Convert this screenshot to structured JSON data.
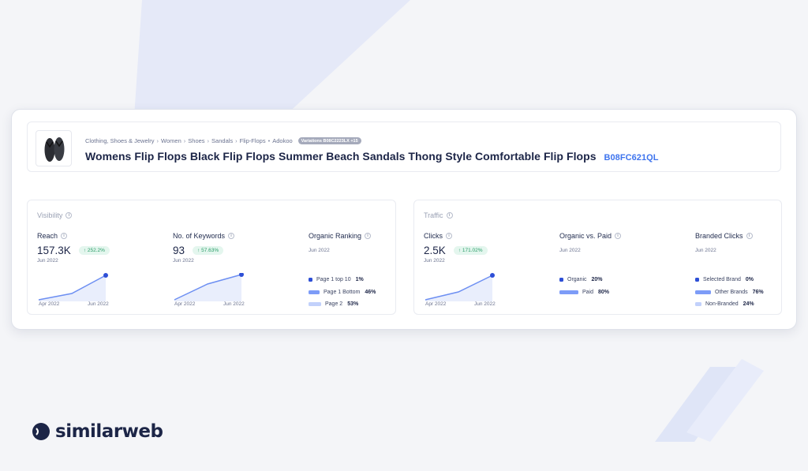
{
  "product": {
    "breadcrumb": [
      "Clothing, Shoes & Jewelry",
      "Women",
      "Shoes",
      "Sandals",
      "Flip-Flops"
    ],
    "brand": "Adokoo",
    "variations_badge": "Variations B08C2223LX +15",
    "title": "Womens Flip Flops Black Flip Flops Summer Beach Sandals Thong Style Comfortable Flip Flops",
    "asin": "B08FC621QL",
    "thumbnail_icon": "flip-flops-icon"
  },
  "visibility": {
    "title": "Visibility",
    "reach": {
      "label": "Reach",
      "value": "157.3K",
      "change": "↑ 252.2%",
      "date": "Jun 2022",
      "axis_start": "Apr 2022",
      "axis_end": "Jun 2022"
    },
    "keywords": {
      "label": "No. of Keywords",
      "value": "93",
      "change": "↑ 57.63%",
      "date": "Jun 2022",
      "axis_start": "Apr 2022",
      "axis_end": "Jun 2022"
    },
    "organic_ranking": {
      "label": "Organic Ranking",
      "date": "Jun 2022",
      "items": [
        {
          "label": "Page 1 top 10",
          "value": "1%",
          "color": "#2e4fd6"
        },
        {
          "label": "Page 1 Bottom",
          "value": "46%",
          "color": "#7d9cf7"
        },
        {
          "label": "Page 2",
          "value": "53%",
          "color": "#c2d1fb"
        }
      ]
    }
  },
  "traffic": {
    "title": "Traffic",
    "clicks": {
      "label": "Clicks",
      "value": "2.5K",
      "change": "↑ 171.02%",
      "date": "Jun 2022",
      "axis_start": "Apr 2022",
      "axis_end": "Jun 2022"
    },
    "organic_vs_paid": {
      "label": "Organic vs. Paid",
      "date": "Jun 2022",
      "items": [
        {
          "label": "Organic",
          "value": "20%",
          "color": "#2e4fd6"
        },
        {
          "label": "Paid",
          "value": "80%",
          "color": "#7d9cf7"
        }
      ]
    },
    "branded_clicks": {
      "label": "Branded Clicks",
      "date": "Jun 2022",
      "items": [
        {
          "label": "Selected Brand",
          "value": "0%",
          "color": "#2e4fd6"
        },
        {
          "label": "Other Brands",
          "value": "76%",
          "color": "#7d9cf7"
        },
        {
          "label": "Non-Branded",
          "value": "24%",
          "color": "#c2d1fb"
        }
      ]
    }
  },
  "brand_logo": {
    "text": "similarweb",
    "colors": {
      "primary": "#1c2547",
      "accent": "#f3702e"
    }
  },
  "theme": {
    "accent": "#3e74ee",
    "positive_bg": "#e4f6ee",
    "positive_text": "#2a9d68"
  }
}
